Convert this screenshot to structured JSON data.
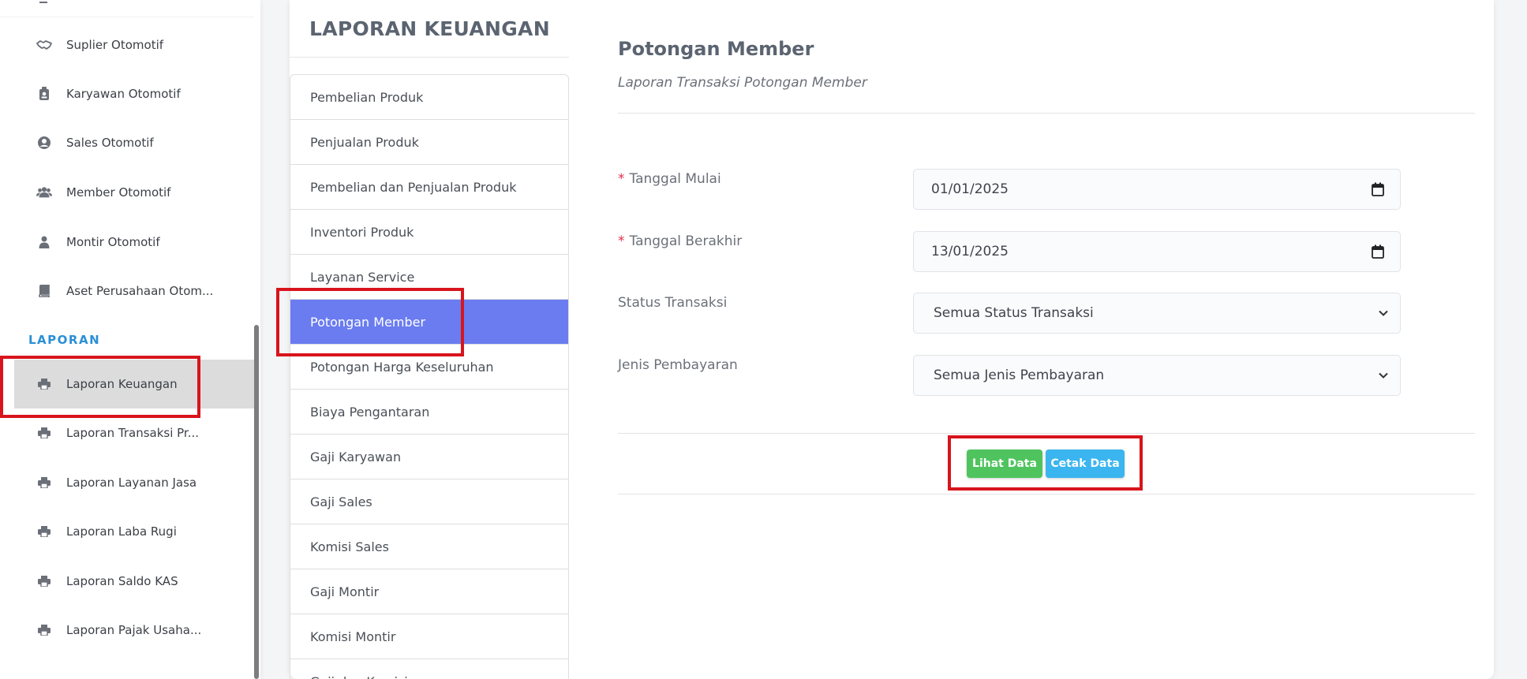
{
  "sidebar": {
    "items": [
      {
        "label": "Suplier Otomotif",
        "icon": "handshake-icon"
      },
      {
        "label": "Karyawan Otomotif",
        "icon": "id-badge-icon"
      },
      {
        "label": "Sales Otomotif",
        "icon": "user-circle-icon"
      },
      {
        "label": "Member Otomotif",
        "icon": "users-icon"
      },
      {
        "label": "Montir Otomotif",
        "icon": "user-icon"
      },
      {
        "label": "Aset Perusahaan Otom...",
        "icon": "book-icon"
      }
    ],
    "section_title": "LAPORAN",
    "report_items": [
      {
        "label": "Laporan Keuangan",
        "icon": "printer-icon",
        "active": true
      },
      {
        "label": "Laporan Transaksi Pr...",
        "icon": "printer-icon"
      },
      {
        "label": "Laporan Layanan Jasa",
        "icon": "printer-icon"
      },
      {
        "label": "Laporan Laba Rugi",
        "icon": "printer-icon"
      },
      {
        "label": "Laporan Saldo KAS",
        "icon": "printer-icon"
      },
      {
        "label": "Laporan Pajak Usaha...",
        "icon": "printer-icon"
      }
    ]
  },
  "card": {
    "title": "LAPORAN KEUANGAN",
    "menu": [
      "Pembelian Produk",
      "Penjualan Produk",
      "Pembelian dan Penjualan Produk",
      "Inventori Produk",
      "Layanan Service",
      "Potongan Member",
      "Potongan Harga Keseluruhan",
      "Biaya Pengantaran",
      "Gaji Karyawan",
      "Gaji Sales",
      "Komisi Sales",
      "Gaji Montir",
      "Komisi Montir",
      "Gaji dan Komisi..."
    ],
    "active_menu": "Potongan Member"
  },
  "report": {
    "title": "Potongan Member",
    "subtitle": "Laporan Transaksi Potongan Member",
    "required_mark": "*",
    "fields": {
      "start_date": {
        "label": "Tanggal Mulai",
        "value": "01/01/2025"
      },
      "end_date": {
        "label": "Tanggal Berakhir",
        "value": "13/01/2025"
      },
      "status": {
        "label": "Status Transaksi",
        "value": "Semua Status Transaksi"
      },
      "payment": {
        "label": "Jenis Pembayaran",
        "value": "Semua Jenis Pembayaran"
      }
    },
    "buttons": {
      "view": "Lihat Data",
      "print": "Cetak Data"
    }
  },
  "colors": {
    "accent": "#6a7cf0",
    "section": "#2a8fd6",
    "view_button": "#4fc45e",
    "print_button": "#3ab5ef",
    "highlight": "#d8141c",
    "required": "#e0314b"
  }
}
